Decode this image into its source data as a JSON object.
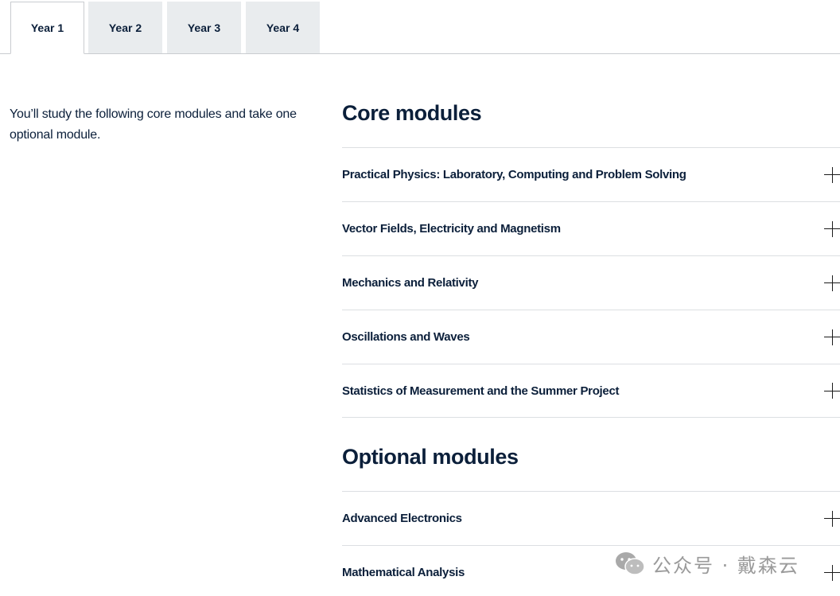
{
  "tabs": [
    {
      "label": "Year 1",
      "active": true
    },
    {
      "label": "Year 2",
      "active": false
    },
    {
      "label": "Year 3",
      "active": false
    },
    {
      "label": "Year 4",
      "active": false
    }
  ],
  "intro_text": "You’ll study the following core modules and take one optional module.",
  "core": {
    "title": "Core modules",
    "items": [
      "Practical Physics: Laboratory, Computing and Problem Solving",
      "Vector Fields, Electricity and Magnetism",
      "Mechanics and Relativity",
      "Oscillations and Waves",
      "Statistics of Measurement and the Summer Project"
    ]
  },
  "optional": {
    "title": "Optional modules",
    "items": [
      "Advanced Electronics",
      "Mathematical Analysis"
    ]
  },
  "watermark": {
    "text": "公众号 · 戴森云",
    "icon": "wechat-icon"
  },
  "colors": {
    "text": "#0b1f3a",
    "tab_bg": "#e9ecee",
    "divider": "#dcdfe2"
  }
}
